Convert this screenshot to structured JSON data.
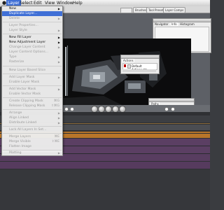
{
  "menubar": {
    "apple": "",
    "items": [
      "Layer",
      "Select",
      "Edit",
      "View",
      "Window",
      "Help"
    ]
  },
  "toolbar": {
    "brushes": "Brushes",
    "tool_presets": "Tool Presets",
    "layer_comps": "Layer Comps"
  },
  "panels": {
    "navigator_tabs": [
      "Navigator",
      "Info",
      "Histogram"
    ],
    "actions_title": "Actions",
    "actions_item": "Default Actions.atn",
    "paths_title": "Paths"
  },
  "layer_menu": {
    "items": [
      {
        "label": "New",
        "submenu": true,
        "enabled": true,
        "highlight": false
      },
      {
        "label": "Duplicate Layer...",
        "enabled": true,
        "highlight": true
      },
      {
        "label": "Delete",
        "submenu": true,
        "enabled": false
      },
      {
        "label": "Layer Properties...",
        "enabled": false
      },
      {
        "label": "Layer Style",
        "submenu": true,
        "enabled": false
      },
      {
        "label": "New Fill Layer",
        "submenu": true,
        "enabled": true
      },
      {
        "label": "New Adjustment Layer",
        "submenu": true,
        "enabled": true
      },
      {
        "label": "Change Layer Content",
        "submenu": true,
        "enabled": false
      },
      {
        "label": "Layer Content Options...",
        "enabled": false
      },
      {
        "label": "Type",
        "submenu": true,
        "enabled": false
      },
      {
        "label": "Rasterize",
        "submenu": true,
        "enabled": false
      },
      {
        "label": "New Layer Based Slice",
        "enabled": false
      },
      {
        "label": "Add Layer Mask",
        "submenu": true,
        "enabled": false
      },
      {
        "label": "Enable Layer Mask",
        "enabled": false
      },
      {
        "label": "Add Vector Mask",
        "submenu": true,
        "enabled": false
      },
      {
        "label": "Enable Vector Mask",
        "enabled": false
      },
      {
        "label": "Create Clipping Mask",
        "shortcut": "⌘G",
        "enabled": false
      },
      {
        "label": "Release Clipping Mask",
        "shortcut": "⇧⌘G",
        "enabled": false
      },
      {
        "label": "Arrange",
        "submenu": true,
        "enabled": false
      },
      {
        "label": "Align Linked",
        "submenu": true,
        "enabled": false
      },
      {
        "label": "Distribute Linked",
        "submenu": true,
        "enabled": false
      },
      {
        "label": "Lock All Layers In Set...",
        "enabled": false
      },
      {
        "label": "Merge Layers",
        "shortcut": "⌘E",
        "enabled": false
      },
      {
        "label": "Merge Visible",
        "shortcut": "⇧⌘E",
        "enabled": false
      },
      {
        "label": "Flatten Image",
        "enabled": false
      },
      {
        "label": "Matting",
        "submenu": true,
        "enabled": false
      }
    ]
  },
  "colors": {
    "menu_highlight": "#3f6fd6",
    "timeline_bg": "#2f3033",
    "track_purple": "#5b3f63",
    "track_orange": "#b8752a"
  }
}
